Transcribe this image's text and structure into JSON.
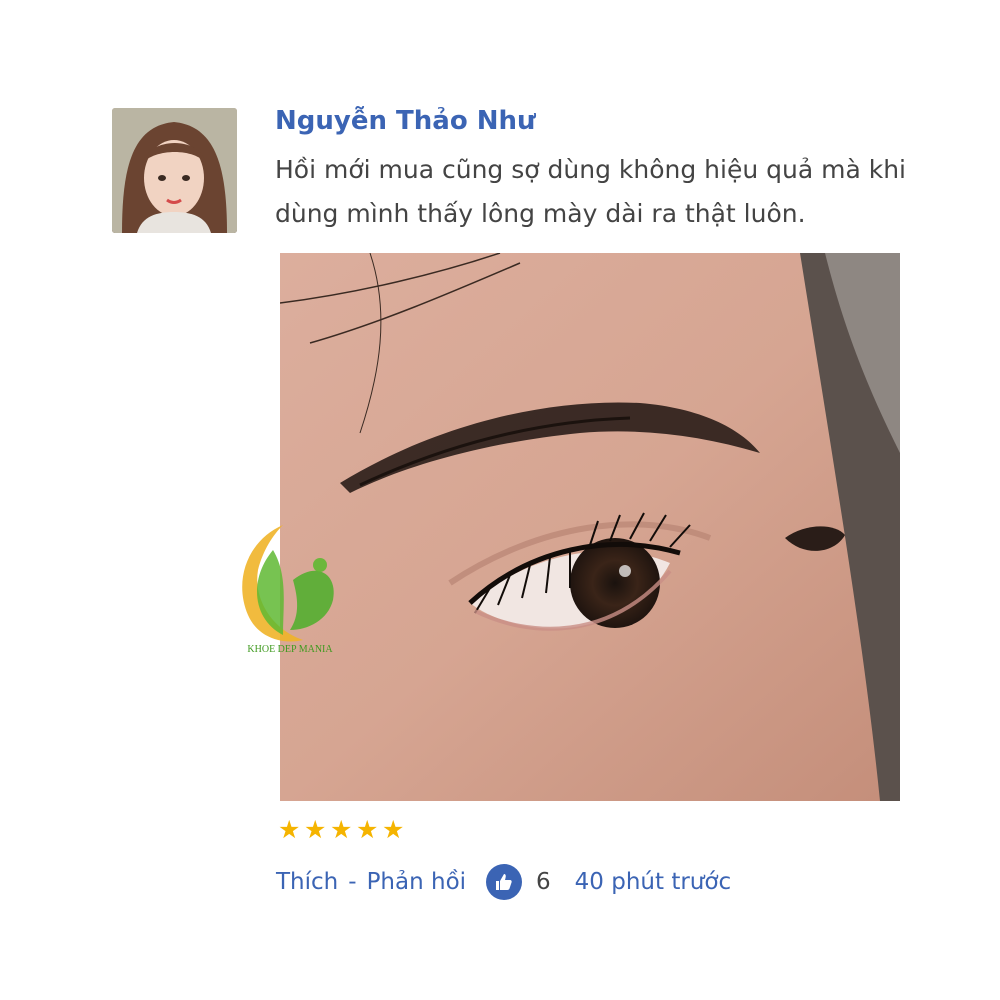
{
  "review": {
    "author": "Nguyễn Thảo Như",
    "comment": "Hồi mới mua cũng sợ dùng không hiệu quả mà khi dùng mình thấy lông mày dài ra thật luôn.",
    "rating": 5,
    "actions": {
      "like_label": "Thích",
      "separator": "-",
      "reply_label": "Phản hồi"
    },
    "like_count": "6",
    "time": "40 phút trước"
  },
  "watermark": {
    "text": "KHOE DEP MANIA"
  },
  "icons": {
    "avatar": "user-photo",
    "like": "thumbs-up-icon",
    "star": "star-icon"
  },
  "colors": {
    "link": "#3b64b4",
    "text": "#444444",
    "star": "#f5b400"
  }
}
